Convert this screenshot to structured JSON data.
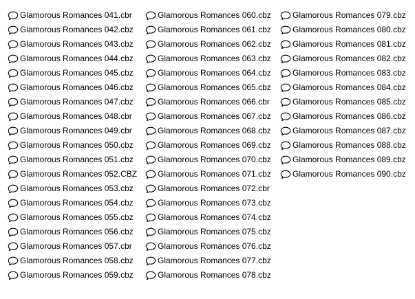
{
  "icon": "speech-bubble-icon",
  "columns": [
    {
      "items": [
        {
          "name": "Glamorous Romances 041.cbr"
        },
        {
          "name": "Glamorous Romances 042.cbz"
        },
        {
          "name": "Glamorous Romances 043.cbz"
        },
        {
          "name": "Glamorous Romances 044.cbz"
        },
        {
          "name": "Glamorous Romances 045.cbz"
        },
        {
          "name": "Glamorous Romances 046.cbz"
        },
        {
          "name": "Glamorous Romances 047.cbz"
        },
        {
          "name": "Glamorous Romances 048.cbr"
        },
        {
          "name": "Glamorous Romances 049.cbr"
        },
        {
          "name": "Glamorous Romances 050.cbz"
        },
        {
          "name": "Glamorous Romances 051.cbz"
        },
        {
          "name": "Glamorous Romances 052.CBZ"
        },
        {
          "name": "Glamorous Romances 053.cbz"
        },
        {
          "name": "Glamorous Romances 054.cbz"
        },
        {
          "name": "Glamorous Romances 055.cbz"
        },
        {
          "name": "Glamorous Romances 056.cbz"
        },
        {
          "name": "Glamorous Romances 057.cbr"
        },
        {
          "name": "Glamorous Romances 058.cbz"
        },
        {
          "name": "Glamorous Romances 059.cbz"
        }
      ]
    },
    {
      "items": [
        {
          "name": "Glamorous Romances 060.cbz"
        },
        {
          "name": "Glamorous Romances 061.cbz"
        },
        {
          "name": "Glamorous Romances 062.cbz"
        },
        {
          "name": "Glamorous Romances 063.cbz"
        },
        {
          "name": "Glamorous Romances 064.cbz"
        },
        {
          "name": "Glamorous Romances 065.cbz"
        },
        {
          "name": "Glamorous Romances 066.cbr"
        },
        {
          "name": "Glamorous Romances 067.cbz"
        },
        {
          "name": "Glamorous Romances 068.cbz"
        },
        {
          "name": "Glamorous Romances 069.cbz"
        },
        {
          "name": "Glamorous Romances 070.cbz"
        },
        {
          "name": "Glamorous Romances 071.cbz"
        },
        {
          "name": "Glamorous Romances 072.cbr"
        },
        {
          "name": "Glamorous Romances 073.cbz"
        },
        {
          "name": "Glamorous Romances 074.cbz"
        },
        {
          "name": "Glamorous Romances 075.cbz"
        },
        {
          "name": "Glamorous Romances 076.cbz"
        },
        {
          "name": "Glamorous Romances 077.cbz"
        },
        {
          "name": "Glamorous Romances 078.cbz"
        }
      ]
    },
    {
      "items": [
        {
          "name": "Glamorous Romances 079.cbz"
        },
        {
          "name": "Glamorous Romances 080.cbz"
        },
        {
          "name": "Glamorous Romances 081.cbz"
        },
        {
          "name": "Glamorous Romances 082.cbz"
        },
        {
          "name": "Glamorous Romances 083.cbz"
        },
        {
          "name": "Glamorous Romances 084.cbz"
        },
        {
          "name": "Glamorous Romances 085.cbz"
        },
        {
          "name": "Glamorous Romances 086.cbz"
        },
        {
          "name": "Glamorous Romances 087.cbz"
        },
        {
          "name": "Glamorous Romances 088.cbz"
        },
        {
          "name": "Glamorous Romances 089.cbz"
        },
        {
          "name": "Glamorous Romances 090.cbz"
        }
      ]
    }
  ]
}
